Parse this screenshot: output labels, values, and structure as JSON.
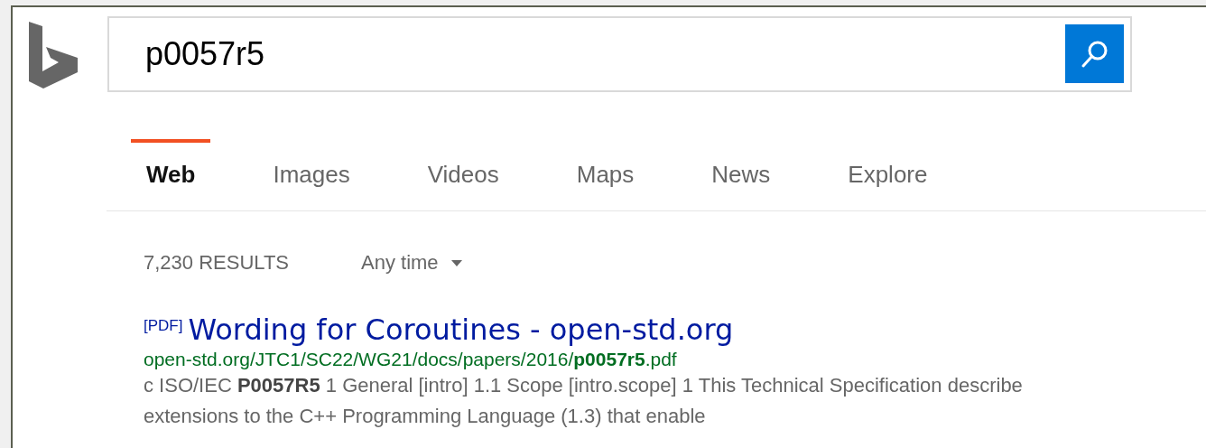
{
  "search": {
    "value": "p0057r5"
  },
  "tabs": [
    {
      "label": "Web",
      "selected": true
    },
    {
      "label": "Images",
      "selected": false
    },
    {
      "label": "Videos",
      "selected": false
    },
    {
      "label": "Maps",
      "selected": false
    },
    {
      "label": "News",
      "selected": false
    },
    {
      "label": "Explore",
      "selected": false
    }
  ],
  "results_count": "7,230 RESULTS",
  "time_filter": "Any time",
  "results": [
    {
      "tag": "[PDF]",
      "title": "Wording for Coroutines - open-std.org",
      "url": "open-std.org/JTC1/SC22/WG21/docs/papers/2016/**p0057r5**.pdf",
      "snippet_lines": [
        "c ISO/IEC **P0057R5** 1 General [intro] 1.1 Scope [intro.scope] 1 This Technical Specification describe",
        "extensions to the C++ Programming Language (1.3) that enable"
      ]
    }
  ]
}
